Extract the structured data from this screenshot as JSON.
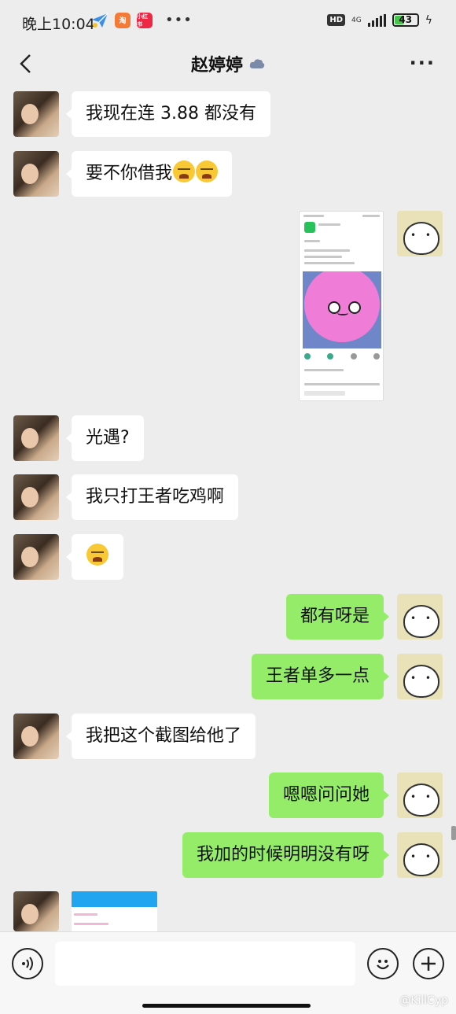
{
  "status_bar": {
    "time": "晚上10:04",
    "app_badges": [
      {
        "label": "✈",
        "color": "#3b8fe6"
      },
      {
        "label": "淘",
        "color": "#f47b37"
      },
      {
        "label": "小红书",
        "color": "#ee2744"
      }
    ],
    "more": "•••",
    "hd": "HD",
    "network": "4G",
    "battery": "43",
    "battery_level": 0.43
  },
  "nav": {
    "title": "赵婷婷",
    "more": "···"
  },
  "messages": [
    {
      "side": "in",
      "text": "我现在连 3.88 都没有"
    },
    {
      "side": "in",
      "text": "要不你借我",
      "emoji_count": 2
    },
    {
      "side": "out",
      "type": "image"
    },
    {
      "side": "in",
      "text": "光遇?"
    },
    {
      "side": "in",
      "text": "我只打王者吃鸡啊"
    },
    {
      "side": "in",
      "type": "emoji",
      "emoji_count": 1
    },
    {
      "side": "out",
      "text": "都有呀是"
    },
    {
      "side": "out",
      "text": "王者单多一点"
    },
    {
      "side": "in",
      "text": "我把这个截图给他了"
    },
    {
      "side": "out",
      "text": "嗯嗯问问她"
    },
    {
      "side": "out",
      "text": "我加的时候明明没有呀"
    },
    {
      "side": "in",
      "type": "image"
    }
  ],
  "input_bar": {
    "value": "",
    "watermark": "@KillCyp"
  },
  "colors": {
    "background": "#ededed",
    "outgoing_bubble": "#95ec69",
    "incoming_bubble": "#ffffff"
  }
}
